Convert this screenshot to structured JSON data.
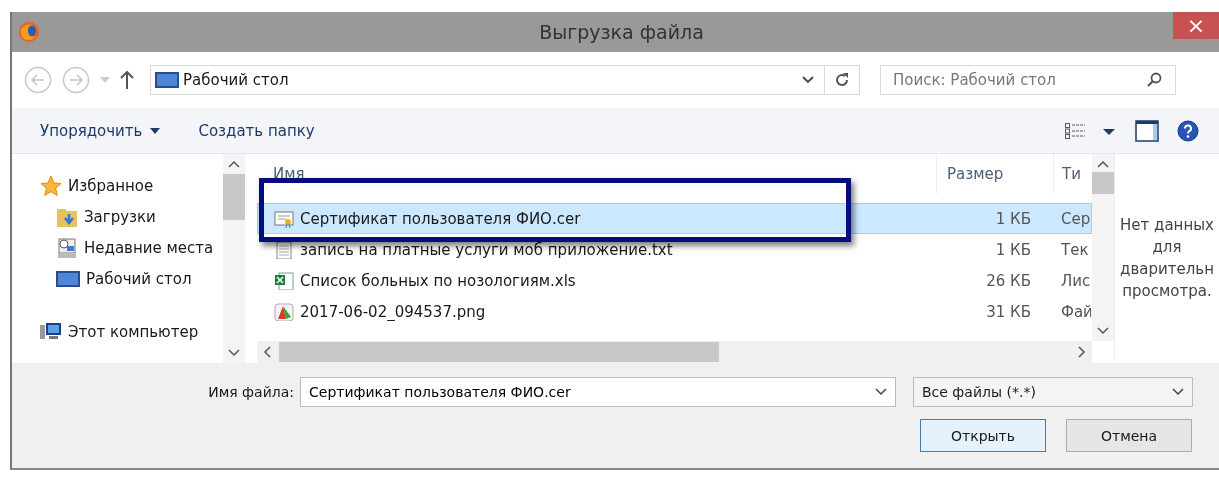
{
  "window": {
    "title": "Выгрузка файла",
    "close": "×"
  },
  "address": {
    "value": "Рабочий стол"
  },
  "search": {
    "placeholder": "Поиск: Рабочий стол"
  },
  "toolbar": {
    "organize": "Упорядочить",
    "new_folder": "Создать папку"
  },
  "sidebar": {
    "items": [
      {
        "label": "Избранное",
        "kind": "star",
        "children": [
          {
            "label": "Загрузки",
            "kind": "downloads"
          },
          {
            "label": "Недавние места",
            "kind": "recent"
          },
          {
            "label": "Рабочий стол",
            "kind": "desktop"
          }
        ]
      },
      {
        "label": "Этот компьютер",
        "kind": "computer"
      }
    ]
  },
  "table": {
    "columns": [
      "Имя",
      "Размер",
      "Ти"
    ],
    "rows": [
      {
        "name": "Сертификат пользователя ФИО.cer",
        "size": "1 КБ",
        "type": "Сер",
        "kind": "cert",
        "selected": true
      },
      {
        "name": "запись на платные услуги моб приложение.txt",
        "size": "1 КБ",
        "type": "Тек",
        "kind": "text",
        "selected": false
      },
      {
        "name": "Список больных по нозологиям.xls",
        "size": "26 КБ",
        "type": "Лис",
        "kind": "excel",
        "selected": false
      },
      {
        "name": "2017-06-02_094537.png",
        "size": "31 КБ",
        "type": "Фай",
        "kind": "image",
        "selected": false
      }
    ]
  },
  "preview": {
    "lines": [
      "Нет данных",
      "для",
      "дварительн",
      "просмотра."
    ]
  },
  "filename": {
    "label": "Имя файла:",
    "value": "Сертификат пользователя ФИО.cer"
  },
  "filter": {
    "value": "Все файлы (*.*)"
  },
  "buttons": [
    {
      "label": "Открыть",
      "default": true
    },
    {
      "label": "Отмена",
      "default": false
    }
  ]
}
